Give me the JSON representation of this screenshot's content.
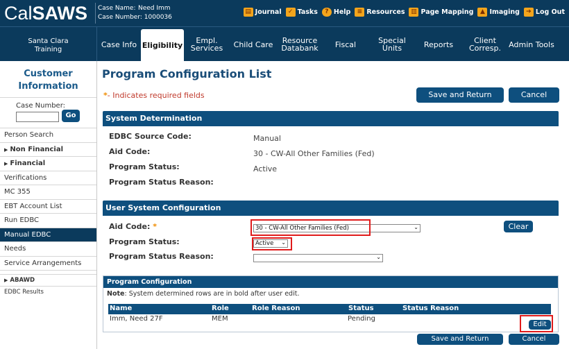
{
  "header": {
    "logo_cal": "Cal",
    "logo_saws": "SAWS",
    "case_name_label": "Case Name:",
    "case_name_value": "Need Imm",
    "case_number_label": "Case Number:",
    "case_number_value": "1000036",
    "links": [
      {
        "label": "Journal",
        "icon": "journal-icon"
      },
      {
        "label": "Tasks",
        "icon": "tasks-icon"
      },
      {
        "label": "Help",
        "icon": "help-icon"
      },
      {
        "label": "Resources",
        "icon": "resources-icon"
      },
      {
        "label": "Page Mapping",
        "icon": "page-mapping-icon"
      },
      {
        "label": "Imaging",
        "icon": "imaging-icon"
      },
      {
        "label": "Log Out",
        "icon": "logout-icon"
      }
    ]
  },
  "nav": {
    "org_line1": "Santa Clara",
    "org_line2": "Training",
    "tabs": [
      {
        "label1": "Case Info",
        "label2": ""
      },
      {
        "label1": "Eligibility",
        "label2": ""
      },
      {
        "label1": "Empl.",
        "label2": "Services"
      },
      {
        "label1": "Child Care",
        "label2": ""
      },
      {
        "label1": "Resource",
        "label2": "Databank"
      },
      {
        "label1": "Fiscal",
        "label2": ""
      },
      {
        "label1": "Special",
        "label2": "Units"
      },
      {
        "label1": "Reports",
        "label2": ""
      },
      {
        "label1": "Client",
        "label2": "Corresp."
      },
      {
        "label1": "Admin Tools",
        "label2": ""
      }
    ]
  },
  "sidebar": {
    "title1": "Customer",
    "title2": "Information",
    "case_number_label": "Case Number:",
    "go_label": "Go",
    "items": [
      "Person Search",
      "Non Financial",
      "Financial",
      "Verifications",
      "MC 355",
      "EBT Account List",
      "Run EDBC",
      "Manual EDBC",
      "Needs",
      "Service Arrangements"
    ],
    "sub_items": [
      "ABAWD",
      "EDBC Results"
    ]
  },
  "main": {
    "title": "Program Configuration List",
    "required_star": "*",
    "required_text": "- Indicates required fields",
    "save_return_label": "Save and Return",
    "cancel_label": "Cancel",
    "system_determination": {
      "heading": "System Determination",
      "edbc_source_label": "EDBC Source Code:",
      "edbc_source_value": "Manual",
      "aid_code_label": "Aid Code:",
      "aid_code_value": "30 - CW-All Other Families (Fed)",
      "program_status_label": "Program Status:",
      "program_status_value": "Active",
      "status_reason_label": "Program Status Reason:"
    },
    "user_config": {
      "heading": "User System Configuration",
      "aid_code_label": "Aid Code:",
      "aid_code_selected": "30 - CW-All Other Families (Fed)",
      "program_status_label": "Program Status:",
      "program_status_selected": "Active",
      "status_reason_label": "Program Status Reason:",
      "status_reason_selected": "",
      "clear_label": "Clear"
    },
    "program_config": {
      "heading": "Program Configuration",
      "note_bold": "Note",
      "note_text": ": System determined rows are in bold after user edit.",
      "columns": [
        "Name",
        "Role",
        "Role Reason",
        "Status",
        "Status Reason"
      ],
      "rows": [
        {
          "name": "Imm, Need 27F",
          "role": "MEM",
          "role_reason": "",
          "status": "Pending",
          "status_reason": ""
        }
      ],
      "edit_label": "Edit"
    },
    "bottom_save_return_label": "Save and Return",
    "bottom_cancel_label": "Cancel"
  }
}
